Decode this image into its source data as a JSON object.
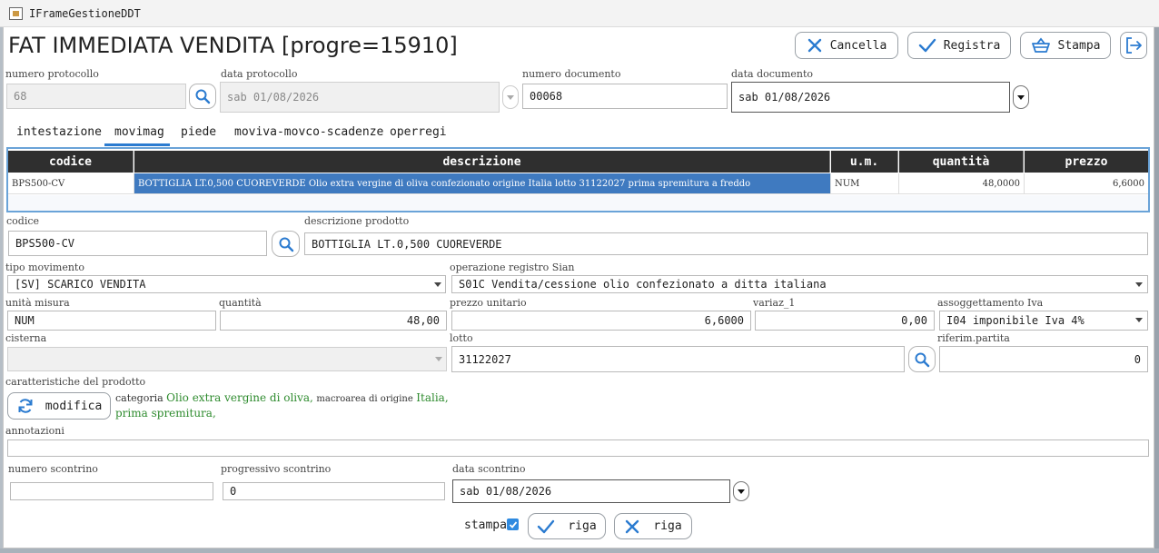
{
  "window": {
    "title": "IFrameGestioneDDT"
  },
  "page_title": "FAT IMMEDIATA VENDITA [progre=15910]",
  "toolbar": {
    "cancel_label": "Cancella",
    "save_label": "Registra",
    "print_label": "Stampa"
  },
  "header": {
    "numero_protocollo": {
      "label": "numero protocollo",
      "value": "68"
    },
    "data_protocollo": {
      "label": "data protocollo",
      "value": "sab 01/08/2026"
    },
    "numero_documento": {
      "label": "numero documento",
      "value": "00068"
    },
    "data_documento": {
      "label": "data documento",
      "value": "sab 01/08/2026"
    }
  },
  "tabs": [
    {
      "label": "intestazione"
    },
    {
      "label": "movimag",
      "active": true
    },
    {
      "label": "piede"
    },
    {
      "label": "moviva-movco-scadenze"
    },
    {
      "label": "operregi"
    }
  ],
  "grid": {
    "columns": [
      "codice",
      "descrizione",
      "u.m.",
      "quantità",
      "prezzo"
    ],
    "rows": [
      {
        "codice": "BPS500-CV",
        "descrizione": "BOTTIGLIA LT.0,500 CUOREVERDE Olio extra vergine di oliva confezionato origine Italia lotto 31122027 prima spremitura a freddo",
        "um": "NUM",
        "quantita": "48,0000",
        "prezzo": "6,6000"
      }
    ]
  },
  "detail": {
    "codice": {
      "label": "codice",
      "value": "BPS500-CV"
    },
    "descrizione_prodotto": {
      "label": "descrizione prodotto",
      "value": "BOTTIGLIA LT.0,500 CUOREVERDE"
    },
    "tipo_movimento": {
      "label": "tipo movimento",
      "value": "[SV] SCARICO VENDITA"
    },
    "operazione_sian": {
      "label": "operazione registro Sian",
      "value": "S01C  Vendita/cessione olio confezionato a ditta italiana"
    },
    "unita_misura": {
      "label": "unità misura",
      "value": "NUM"
    },
    "quantita": {
      "label": "quantità",
      "value": "48,00"
    },
    "prezzo_unitario": {
      "label": "prezzo unitario",
      "value": "6,6000"
    },
    "variaz_1": {
      "label": "variaz_1",
      "value": "0,00"
    },
    "assoggettamento_iva": {
      "label": "assoggettamento Iva",
      "value": "I04   imponibile Iva 4%"
    },
    "cisterna": {
      "label": "cisterna",
      "value": ""
    },
    "lotto": {
      "label": "lotto",
      "value": "31122027"
    },
    "riferim_partita": {
      "label": "riferim.partita",
      "value": "0"
    }
  },
  "caratteristiche": {
    "label": "caratteristiche del prodotto",
    "modify_label": "modifica",
    "categoria_key": "categoria",
    "categoria_value": "Olio extra vergine di oliva,",
    "macroarea_key": "macroarea di origine",
    "macroarea_value": "Italia,",
    "extra_value": "prima spremitura,"
  },
  "annotazioni": {
    "label": "annotazioni",
    "value": ""
  },
  "scontrino": {
    "numero": {
      "label": "numero scontrino",
      "value": ""
    },
    "progressivo": {
      "label": "progressivo scontrino",
      "value": "0"
    },
    "data": {
      "label": "data scontrino",
      "value": "sab 01/08/2026"
    }
  },
  "footer": {
    "stampa_label": "stampa",
    "stampa_checked": true,
    "confirm_row_label": "riga",
    "cancel_row_label": "riga"
  },
  "colors": {
    "accent": "#2b7bd0",
    "selection": "#3f7ac0",
    "grid_header": "#2f2f2f",
    "green_text": "#2e8b2e"
  }
}
